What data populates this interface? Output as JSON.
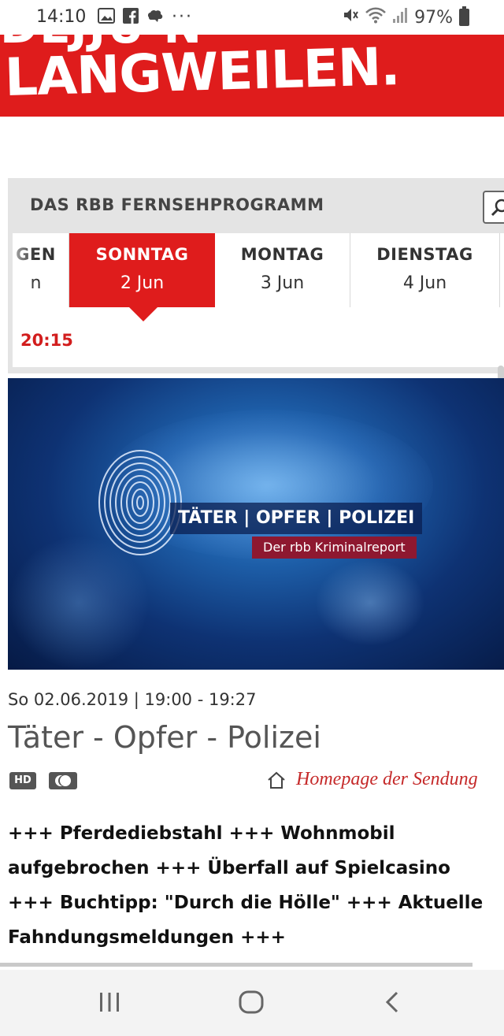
{
  "status_bar": {
    "time": "14:10",
    "battery": "97%",
    "icons": [
      "image-icon",
      "facebook-icon",
      "notification-icon",
      "more-icon",
      "mute-icon",
      "wifi-icon",
      "signal-icon",
      "battery-icon"
    ]
  },
  "banner": {
    "partial_text": "DLJJU N",
    "main_text": "LANGWEILEN.",
    "color": "#df1c1c"
  },
  "program_widget": {
    "title": "DAS RBB FERNSEHPROGRAMM",
    "days": [
      {
        "name": "GEN",
        "date": "n",
        "active": false
      },
      {
        "name": "SONNTAG",
        "date": "2 Jun",
        "active": true
      },
      {
        "name": "MONTAG",
        "date": "3 Jun",
        "active": false
      },
      {
        "name": "DIENSTAG",
        "date": "4 Jun",
        "active": false
      }
    ],
    "selected_time": "20:15"
  },
  "hero": {
    "logo_title": "TÄTER | OPFER | POLIZEI",
    "logo_subtitle": "Der rbb Kriminalreport"
  },
  "program": {
    "airdate": "So 02.06.2019 | 19:00 - 19:27",
    "title": "Täter - Opfer - Polizei",
    "badges": [
      "HD",
      "UT"
    ],
    "homepage_link": "Homepage der Sendung",
    "description_lines": [
      "+++ Pferdediebstahl +++ Wohnmobil",
      "aufgebrochen +++ Überfall auf Spielcasino",
      "+++ Buchtipp: \"Durch die Hölle\" +++ Aktuelle",
      "Fahndungsmeldungen +++"
    ]
  },
  "nav_bar": {
    "buttons": [
      "recent-apps-icon",
      "home-icon",
      "back-icon"
    ]
  },
  "colors": {
    "accent_red": "#df1c1c",
    "time_red": "#d21d1d",
    "link_red": "#c52929"
  }
}
